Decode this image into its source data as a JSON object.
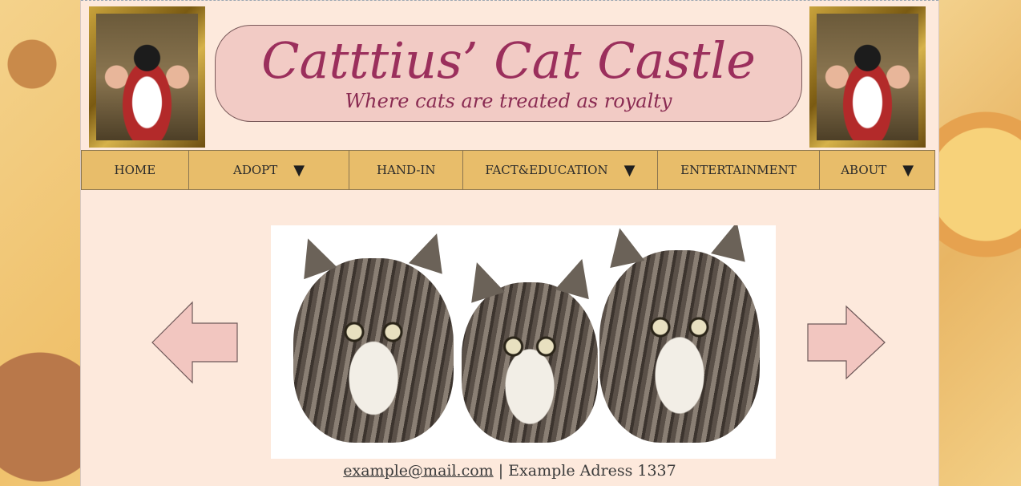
{
  "header": {
    "title": "Catttius’ Cat Castle",
    "subtitle": "Where cats are treated as royalty"
  },
  "nav": {
    "items": [
      {
        "label": "HOME",
        "dropdown": false
      },
      {
        "label": "ADOPT",
        "dropdown": true
      },
      {
        "label": "HAND-IN",
        "dropdown": false
      },
      {
        "label": "FACT&EDUCATION",
        "dropdown": true
      },
      {
        "label": "ENTERTAINMENT",
        "dropdown": false
      },
      {
        "label": "ABOUT",
        "dropdown": true
      }
    ],
    "caret": "▼"
  },
  "footer": {
    "email": "example@mail.com",
    "separator": " | ",
    "address": "Example Adress 1337"
  },
  "colors": {
    "page_bg": "#fde9dc",
    "nav_bg": "#e8bd6a",
    "title": "#9b2f5c",
    "header_box": "#f2cbc5",
    "arrow_fill": "#f2c6c0"
  },
  "icons": {
    "prev": "left-arrow-icon",
    "next": "right-arrow-icon",
    "portrait": "royal-cat-portrait"
  }
}
